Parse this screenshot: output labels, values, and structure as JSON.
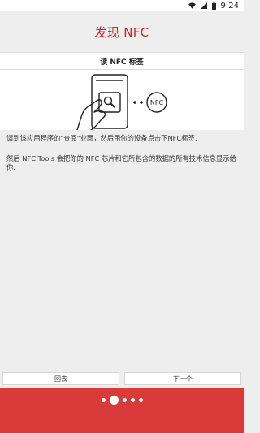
{
  "status_bar": {
    "time": "9:24"
  },
  "header": {
    "title": "发现 NFC"
  },
  "section": {
    "title": "读 NFC 标签"
  },
  "illustration": {
    "badge_text": "NFC"
  },
  "content": {
    "paragraph1": "请到该应用程序的\"查阅\"业面，然后用你的设备点击下NFC标签.",
    "paragraph2": "然后 NFC Tools 会把你的 NFC 芯片和它所包含的数据的所有技术信息显示给你."
  },
  "buttons": {
    "back": "回去",
    "next": "下一个"
  },
  "pager": {
    "count": 5,
    "active_index": 1
  },
  "colors": {
    "accent": "#d93a3a",
    "title": "#c62828"
  }
}
